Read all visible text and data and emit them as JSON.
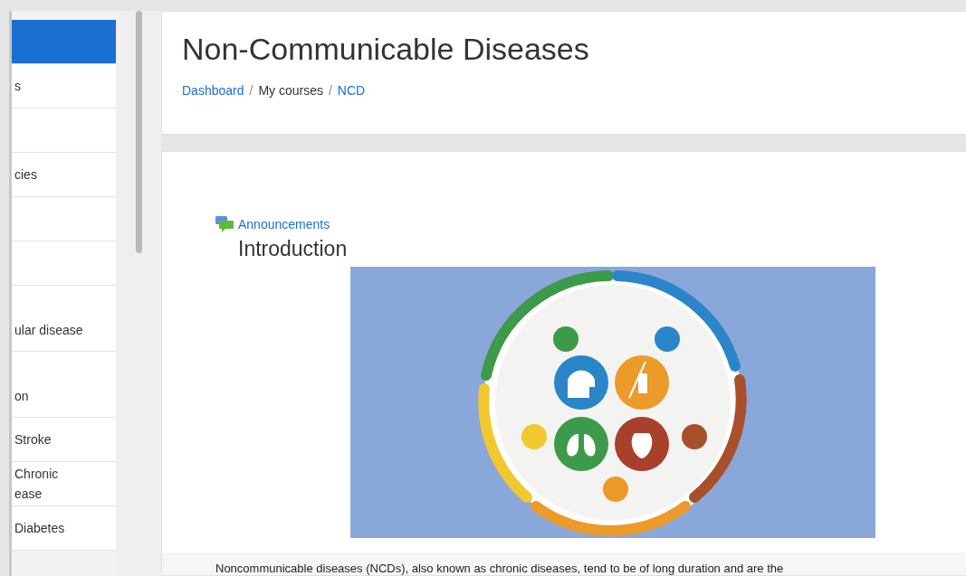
{
  "sidebar": {
    "items": [
      {
        "selected": true
      },
      {
        "label": "s",
        "selected": false
      },
      {
        "selected": false
      },
      {
        "label": "cies",
        "selected": false
      },
      {
        "selected": false
      },
      {
        "selected": false
      },
      {
        "label": "ular disease",
        "selected": false,
        "tall": true
      },
      {
        "label": "on",
        "selected": false,
        "tall": true
      },
      {
        "label": "Stroke",
        "selected": false
      },
      {
        "label": "Chronic\nease",
        "selected": false
      },
      {
        "label": "Diabetes",
        "selected": false
      }
    ]
  },
  "header": {
    "title": "Non-Communicable Diseases",
    "breadcrumb": [
      {
        "label": "Dashboard",
        "link": true
      },
      {
        "label": "My courses",
        "link": false
      },
      {
        "label": "NCD",
        "link": true
      }
    ],
    "separator": "/"
  },
  "content": {
    "announcements": "Announcements",
    "section_title": "Introduction",
    "paragraph": "Noncommunicable diseases (NCDs), also known as chronic diseases, tend to be of long duration and are the"
  }
}
